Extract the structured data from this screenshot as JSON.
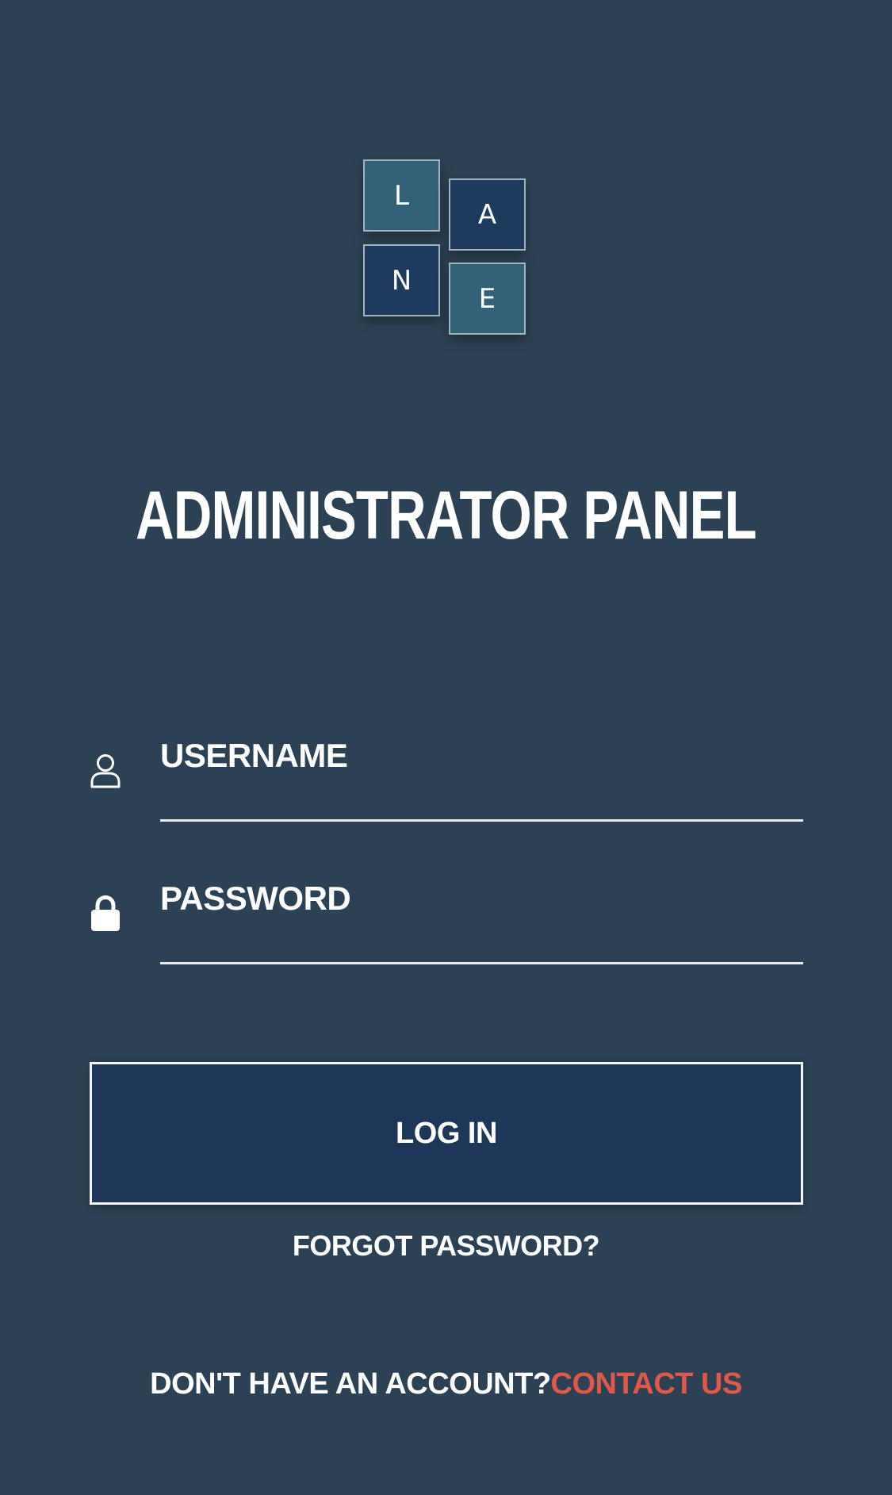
{
  "logo": {
    "tiles": [
      "L",
      "A",
      "N",
      "E"
    ],
    "colors": {
      "light_tile": "#336278",
      "dark_tile": "#1e3a5c"
    }
  },
  "page": {
    "title": "ADMINISTRATOR PANEL",
    "background": "#2c4254"
  },
  "form": {
    "username": {
      "icon": "user-icon",
      "placeholder": "USERNAME",
      "value": ""
    },
    "password": {
      "icon": "lock-icon",
      "placeholder": "PASSWORD",
      "value": ""
    },
    "login_label": "LOG IN",
    "forgot_label": "FORGOT PASSWORD?"
  },
  "footer": {
    "prompt": "DON'T HAVE AN ACCOUNT?",
    "contact_label": "CONTACT US",
    "contact_color": "#e05848"
  }
}
